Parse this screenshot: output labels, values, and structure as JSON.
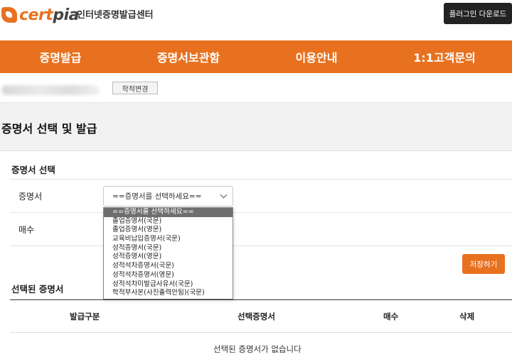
{
  "header": {
    "logo_cert": "cert",
    "logo_pia": "pia",
    "subtitle": "인터넷증명발급센터",
    "plugin_button": "플러그인 다운로드"
  },
  "nav": {
    "items": [
      {
        "label": "증명발급"
      },
      {
        "label": "증명서보관함"
      },
      {
        "label": "이용안내"
      },
      {
        "label": "1:1고객문의"
      }
    ]
  },
  "student": {
    "change_button": "학적변경"
  },
  "page": {
    "title": "증명서 선택 및 발급"
  },
  "selection": {
    "section_title": "증명서 선택",
    "certificate_label": "증명서",
    "quantity_label": "매수",
    "select_value": "==증명서를 선택하세요==",
    "options": [
      "==증명서를 선택하세요==",
      "졸업증명서(국문)",
      "졸업증명서(영문)",
      "교육비납입증명서(국문)",
      "성적증명서(국문)",
      "성적증명서(영문)",
      "성적석차증명서(국문)",
      "성적석차증명서(영문)",
      "성적석차미발급사유서(국문)",
      "학적부사본(사진출력안됨)(국문)"
    ],
    "save_button": "저장하기"
  },
  "selected": {
    "section_title": "선택된 증명서",
    "columns": [
      "발급구분",
      "선택증명서",
      "매수",
      "삭제"
    ],
    "empty_message": "선택된 증명서가 없습니다"
  },
  "colors": {
    "accent": "#e8711f"
  }
}
